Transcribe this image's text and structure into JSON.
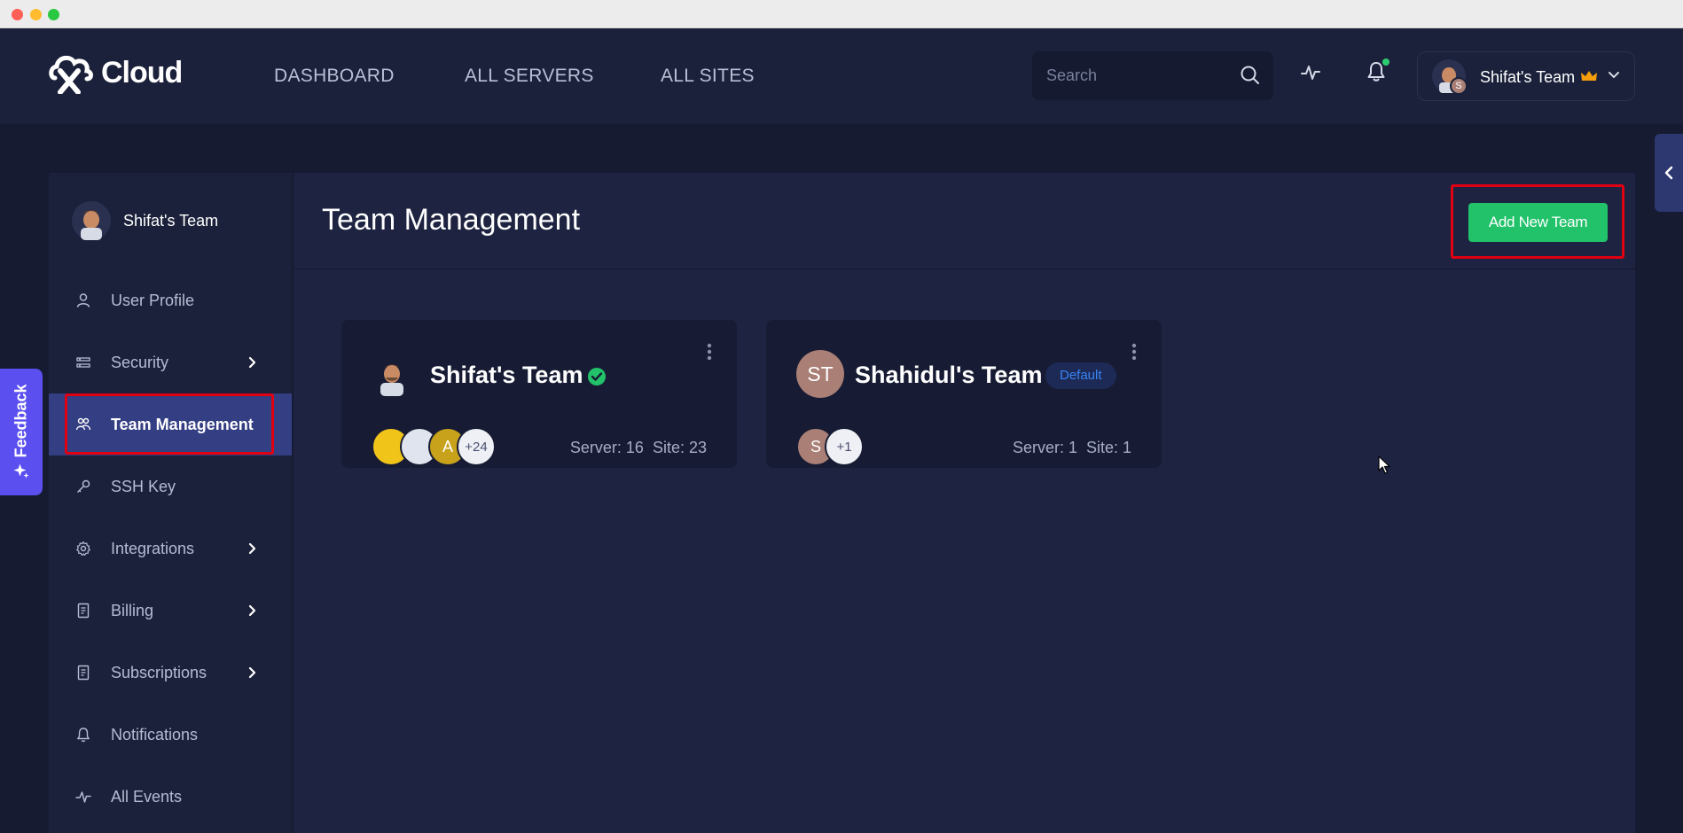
{
  "app": {
    "logo_text": "Cloud",
    "nav": [
      "DASHBOARD",
      "ALL SERVERS",
      "ALL SITES"
    ],
    "search_placeholder": "Search",
    "team_switcher": {
      "name": "Shifat's Team",
      "badge_initial": "S"
    }
  },
  "feedback": {
    "label": "Feedback"
  },
  "sidebar": {
    "team_name": "Shifat's Team",
    "items": [
      {
        "label": "User Profile",
        "icon": "user-icon",
        "has_arrow": false
      },
      {
        "label": "Security",
        "icon": "security-icon",
        "has_arrow": true
      },
      {
        "label": "Team Management",
        "icon": "team-icon",
        "has_arrow": false,
        "active": true
      },
      {
        "label": "SSH Key",
        "icon": "key-icon",
        "has_arrow": false
      },
      {
        "label": "Integrations",
        "icon": "gear-icon",
        "has_arrow": true
      },
      {
        "label": "Billing",
        "icon": "billing-icon",
        "has_arrow": true
      },
      {
        "label": "Subscriptions",
        "icon": "subscriptions-icon",
        "has_arrow": true
      },
      {
        "label": "Notifications",
        "icon": "bell-icon",
        "has_arrow": false
      },
      {
        "label": "All Events",
        "icon": "pulse-icon",
        "has_arrow": false
      }
    ]
  },
  "main": {
    "title": "Team Management",
    "add_button": "Add New Team",
    "teams": [
      {
        "name": "Shifat's Team",
        "verified": true,
        "members": [
          "",
          "",
          "A",
          "+24"
        ],
        "stats": "Server: 16  Site: 23"
      },
      {
        "name": "Shahidul's Team",
        "initials": "ST",
        "badge": "Default",
        "members": [
          "S",
          "+1"
        ],
        "stats": "Server: 1  Site: 1"
      }
    ]
  },
  "colors": {
    "accent_green": "#22c26a",
    "active_nav": "#343e82",
    "feedback_purple": "#5b4ff0",
    "highlight_red": "#e00012",
    "default_badge_text": "#3a84f7"
  }
}
